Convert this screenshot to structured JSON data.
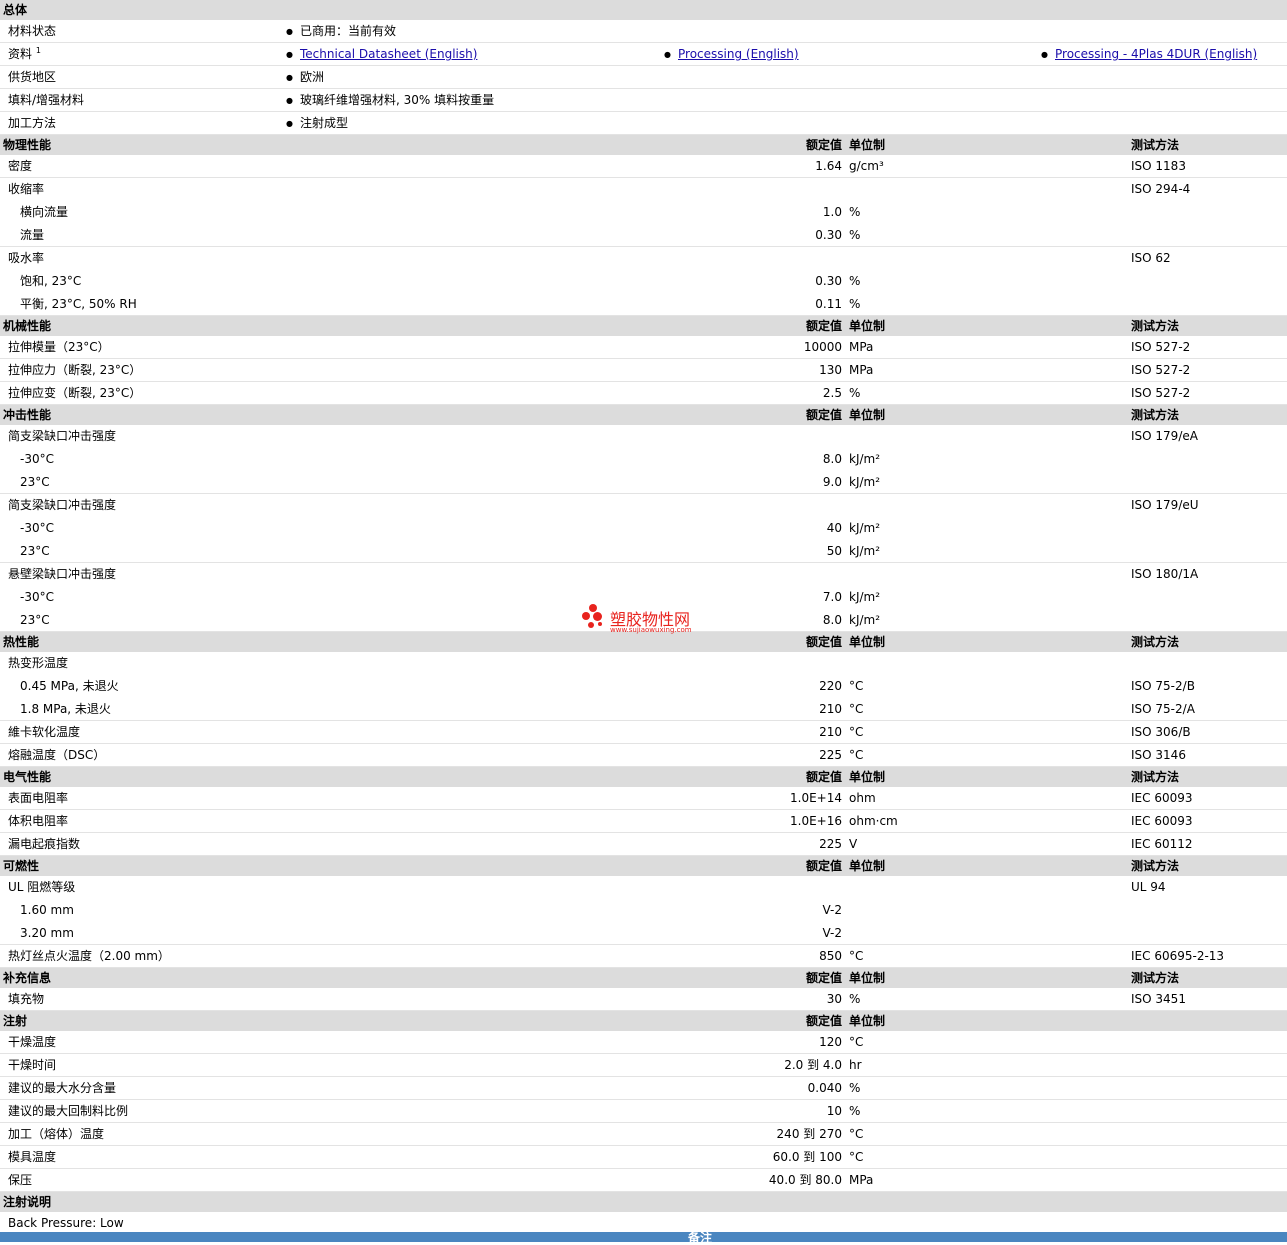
{
  "general": {
    "title": "总体",
    "rows": [
      {
        "label": "材料状态",
        "value": "已商用：当前有效"
      },
      {
        "label": "资料",
        "footnote": "1",
        "links": [
          "Technical Datasheet (English)",
          "Processing (English)",
          "Processing - 4Plas 4DUR (English)"
        ]
      },
      {
        "label": "供货地区",
        "value": "欧洲"
      },
      {
        "label": "填料/增强材料",
        "value": "玻璃纤维增强材料, 30% 填料按重量"
      },
      {
        "label": "加工方法",
        "value": "注射成型"
      }
    ]
  },
  "headers": {
    "nominal": "额定值",
    "unit": "单位制",
    "method": "测试方法"
  },
  "physical": {
    "title": "物理性能",
    "rows": [
      {
        "label": "密度",
        "nominal": "1.64",
        "unit": "g/cm³",
        "method": "ISO 1183"
      },
      {
        "label": "收缩率",
        "nominal": "",
        "unit": "",
        "method": "ISO 294-4"
      },
      {
        "label": "横向流量",
        "nominal": "1.0",
        "unit": "%",
        "method": ""
      },
      {
        "label": "流量",
        "nominal": "0.30",
        "unit": "%",
        "method": ""
      },
      {
        "label": "吸水率",
        "nominal": "",
        "unit": "",
        "method": "ISO 62"
      },
      {
        "label": "饱和, 23°C",
        "nominal": "0.30",
        "unit": "%",
        "method": ""
      },
      {
        "label": "平衡, 23°C, 50% RH",
        "nominal": "0.11",
        "unit": "%",
        "method": ""
      }
    ]
  },
  "mechanical": {
    "title": "机械性能",
    "rows": [
      {
        "label": "拉伸模量（23°C）",
        "nominal": "10000",
        "unit": "MPa",
        "method": "ISO 527-2"
      },
      {
        "label": "拉伸应力（断裂, 23°C）",
        "nominal": "130",
        "unit": "MPa",
        "method": "ISO 527-2"
      },
      {
        "label": "拉伸应变（断裂, 23°C）",
        "nominal": "2.5",
        "unit": "%",
        "method": "ISO 527-2"
      }
    ]
  },
  "impact": {
    "title": "冲击性能",
    "rows": [
      {
        "label": "简支梁缺口冲击强度",
        "nominal": "",
        "unit": "",
        "method": "ISO 179/eA"
      },
      {
        "label": "-30°C",
        "nominal": "8.0",
        "unit": "kJ/m²",
        "method": ""
      },
      {
        "label": "23°C",
        "nominal": "9.0",
        "unit": "kJ/m²",
        "method": ""
      },
      {
        "label": "简支梁缺口冲击强度",
        "nominal": "",
        "unit": "",
        "method": "ISO 179/eU"
      },
      {
        "label": "-30°C",
        "nominal": "40",
        "unit": "kJ/m²",
        "method": ""
      },
      {
        "label": "23°C",
        "nominal": "50",
        "unit": "kJ/m²",
        "method": ""
      },
      {
        "label": "悬壁梁缺口冲击强度",
        "nominal": "",
        "unit": "",
        "method": "ISO 180/1A"
      },
      {
        "label": "-30°C",
        "nominal": "7.0",
        "unit": "kJ/m²",
        "method": ""
      },
      {
        "label": "23°C",
        "nominal": "8.0",
        "unit": "kJ/m²",
        "method": ""
      }
    ]
  },
  "thermal": {
    "title": "热性能",
    "rows": [
      {
        "label": "热变形温度",
        "nominal": "",
        "unit": "",
        "method": ""
      },
      {
        "label": "0.45 MPa, 未退火",
        "nominal": "220",
        "unit": "°C",
        "method": "ISO 75-2/B"
      },
      {
        "label": "1.8 MPa, 未退火",
        "nominal": "210",
        "unit": "°C",
        "method": "ISO 75-2/A"
      },
      {
        "label": "維卡软化温度",
        "nominal": "210",
        "unit": "°C",
        "method": "ISO 306/B"
      },
      {
        "label": "熔融温度（DSC）",
        "nominal": "225",
        "unit": "°C",
        "method": "ISO 3146"
      }
    ]
  },
  "electrical": {
    "title": "电气性能",
    "rows": [
      {
        "label": "表面电阻率",
        "nominal": "1.0E+14",
        "unit": "ohm",
        "method": "IEC 60093"
      },
      {
        "label": "体积电阻率",
        "nominal": "1.0E+16",
        "unit": "ohm·cm",
        "method": "IEC 60093"
      },
      {
        "label": "漏电起痕指数",
        "nominal": "225",
        "unit": "V",
        "method": "IEC 60112"
      }
    ]
  },
  "flammability": {
    "title": "可燃性",
    "rows": [
      {
        "label": "UL 阻燃等级",
        "nominal": "",
        "unit": "",
        "method": "UL 94"
      },
      {
        "label": "1.60 mm",
        "nominal": "V-2",
        "unit": "",
        "method": ""
      },
      {
        "label": "3.20 mm",
        "nominal": "V-2",
        "unit": "",
        "method": ""
      },
      {
        "label": "热灯丝点火温度（2.00 mm）",
        "nominal": "850",
        "unit": "°C",
        "method": "IEC 60695-2-13"
      }
    ]
  },
  "supplemental": {
    "title": "补充信息",
    "rows": [
      {
        "label": "填充物",
        "nominal": "30",
        "unit": "%",
        "method": "ISO 3451"
      }
    ]
  },
  "injection": {
    "title": "注射",
    "rows": [
      {
        "label": "干燥温度",
        "nominal": "120",
        "unit": "°C"
      },
      {
        "label": "干燥时间",
        "nominal": "2.0 到  4.0",
        "unit": "hr"
      },
      {
        "label": "建议的最大水分含量",
        "nominal": "0.040",
        "unit": "%"
      },
      {
        "label": "建议的最大回制料比例",
        "nominal": "10",
        "unit": "%"
      },
      {
        "label": "加工（熔体）温度",
        "nominal": "240 到  270",
        "unit": "°C"
      },
      {
        "label": "模具温度",
        "nominal": "60.0 到  100",
        "unit": "°C"
      },
      {
        "label": "保压",
        "nominal": "40.0 到  80.0",
        "unit": "MPa"
      }
    ]
  },
  "injection_notes": {
    "title": "注射说明",
    "text": "Back Pressure: Low"
  },
  "footer": {
    "title": "备注"
  },
  "watermark": {
    "name": "塑胶物性网",
    "url": "www.sujiaowuxing.com",
    "color": "#e8231e"
  }
}
